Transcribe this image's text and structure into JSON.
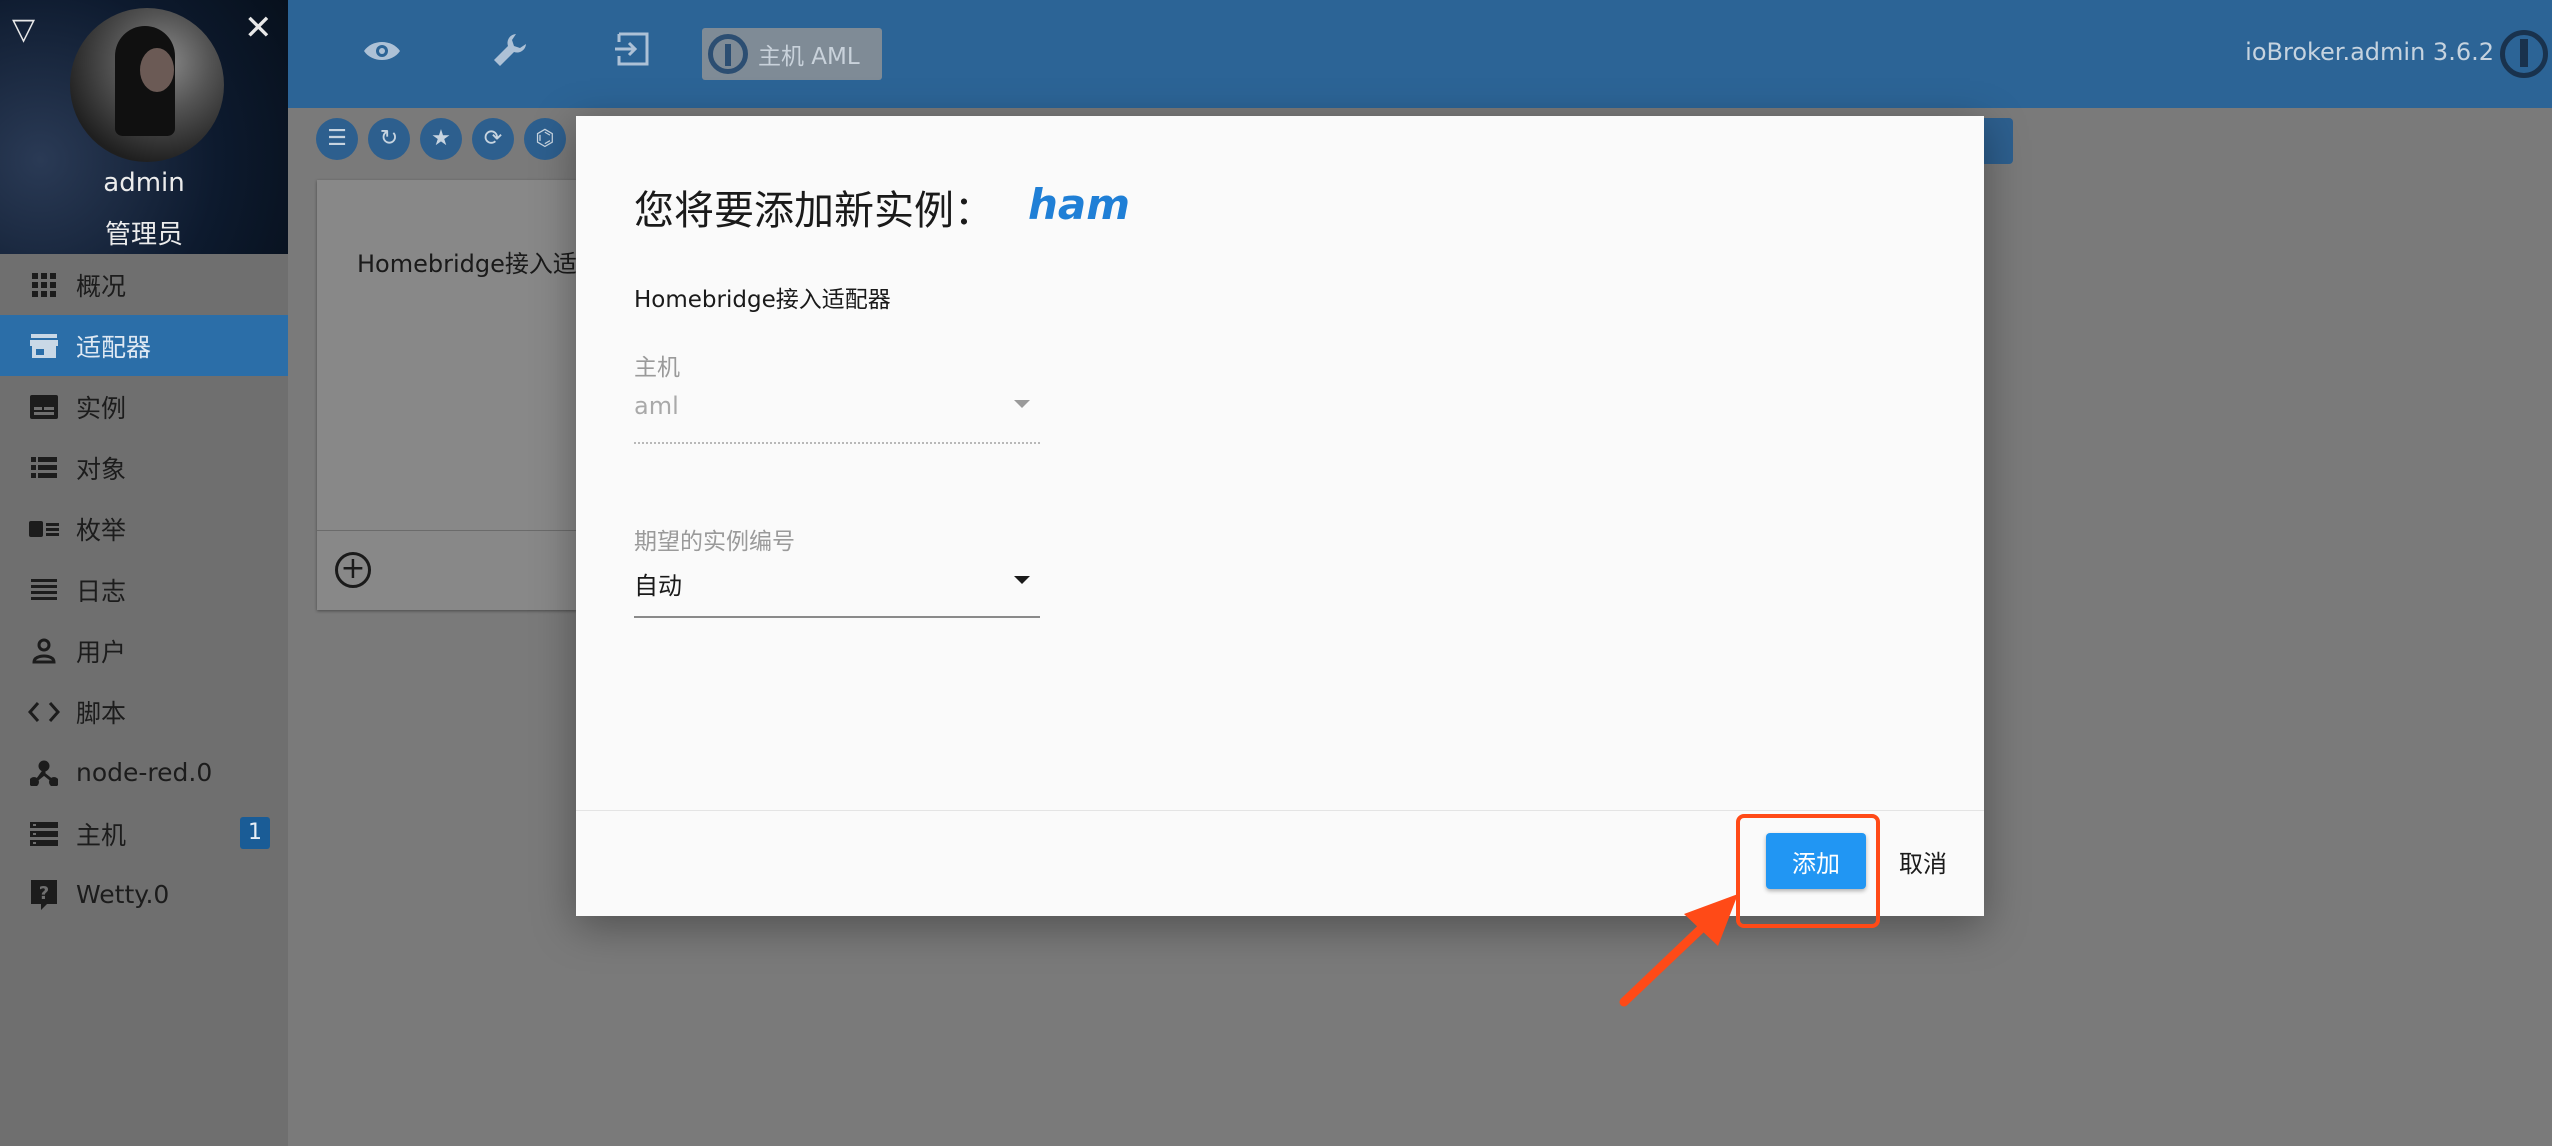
{
  "sidebar": {
    "user": "admin",
    "role": "管理员",
    "items": [
      {
        "label": "概况",
        "icon": "grid-icon"
      },
      {
        "label": "适配器",
        "icon": "store-icon",
        "active": true
      },
      {
        "label": "实例",
        "icon": "instances-icon"
      },
      {
        "label": "对象",
        "icon": "list-icon"
      },
      {
        "label": "枚举",
        "icon": "enum-icon"
      },
      {
        "label": "日志",
        "icon": "log-icon"
      },
      {
        "label": "用户",
        "icon": "user-icon"
      },
      {
        "label": "脚本",
        "icon": "code-icon"
      },
      {
        "label": "node-red.0",
        "icon": "node-red-icon"
      },
      {
        "label": "主机",
        "icon": "hosts-icon",
        "badge": "1"
      },
      {
        "label": "Wetty.0",
        "icon": "help-icon"
      }
    ]
  },
  "topbar": {
    "host_button": "主机 AML",
    "version": "ioBroker.admin 3.6.2"
  },
  "card": {
    "title": "Homebridge接入适配器"
  },
  "dialog": {
    "title": "您将要添加新实例：",
    "adapter_name": "ham",
    "description": "Homebridge接入适配器",
    "host_label": "主机",
    "host_value": "aml",
    "instance_label": "期望的实例编号",
    "instance_value": "自动",
    "add_button": "添加",
    "cancel_button": "取消"
  },
  "colors": {
    "topbar": "#2c6496",
    "active_nav": "#2b6ea8",
    "primary_button": "#2196f3",
    "adapter_name": "#1f7fd6",
    "annotation": "#ff4a17"
  }
}
